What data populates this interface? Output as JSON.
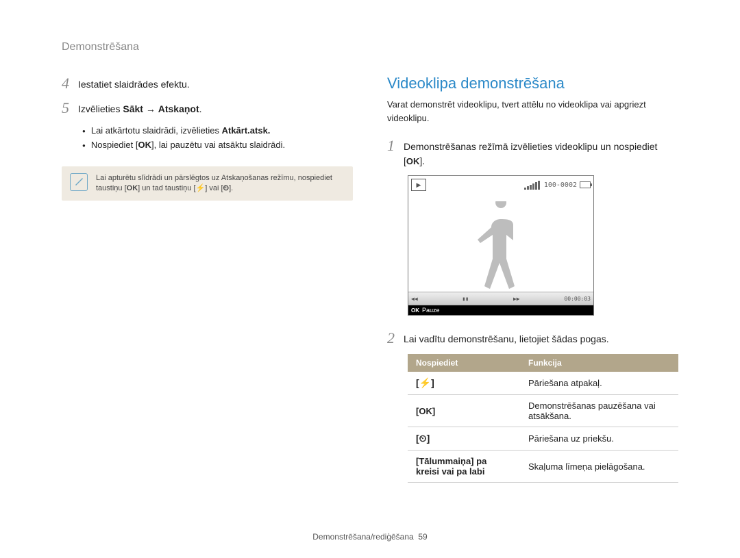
{
  "header": "Demonstrēšana",
  "left": {
    "step4": {
      "num": "4",
      "text": "Iestatiet slaidrādes efektu."
    },
    "step5": {
      "num": "5",
      "pre": "Izvēlieties ",
      "bold1": "Sākt",
      "arrow": " → ",
      "bold2": "Atskaņot",
      "post": "."
    },
    "bullet1_pre": "Lai atkārtotu slaidrādi, izvēlieties ",
    "bullet1_bold": "Atkārt.atsk.",
    "bullet2_pre": "Nospiediet [",
    "bullet2_ok": "OK",
    "bullet2_post": "], lai pauzētu vai atsāktu slaidrādi.",
    "note": "Lai apturētu slīdrādi un pārslēgtos uz Atskaņošanas režīmu, nospiediet taustiņu [",
    "note_ok": "OK",
    "note_mid": "] un tad taustiņu [",
    "note_flash": "⚡",
    "note_mid2": "] vai [",
    "note_timer": "⏲",
    "note_end": "]."
  },
  "right": {
    "title": "Videoklipa demonstrēšana",
    "intro": "Varat demonstrēt videoklipu, tvert attēlu no videoklipa vai apgriezt videoklipu.",
    "step1": {
      "num": "1",
      "text_pre": "Demonstrēšanas režīmā izvēlieties videoklipu un nospiediet [",
      "ok": "OK",
      "text_post": "]."
    },
    "preview": {
      "top_code": "100-0002",
      "time": "00:00:03",
      "ok": "OK",
      "pause": "Pauze"
    },
    "step2": {
      "num": "2",
      "text": "Lai vadītu demonstrēšanu, lietojiet šādas pogas."
    },
    "table": {
      "h1": "Nospiediet",
      "h2": "Funkcija",
      "rows": [
        {
          "btn": "[⚡]",
          "func": "Pāriešana atpakaļ."
        },
        {
          "btn": "[OK]",
          "func": "Demonstrēšanas pauzēšana vai atsākšana."
        },
        {
          "btn": "[⏲]",
          "func": "Pāriešana uz priekšu."
        },
        {
          "btn": "[Tālummaiņa] pa kreisi vai pa labi",
          "func": "Skaļuma līmeņa pielāgošana."
        }
      ]
    }
  },
  "footer": {
    "label": "Demonstrēšana/rediģēšana",
    "page": "59"
  }
}
